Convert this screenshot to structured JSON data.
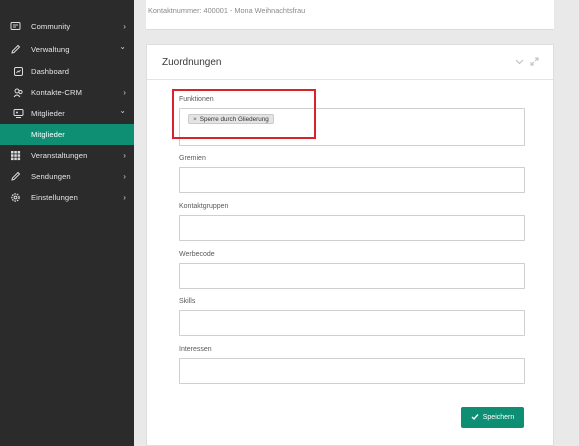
{
  "sidebar": {
    "items": [
      {
        "label": "Community",
        "icon": "community-icon"
      },
      {
        "label": "Verwaltung",
        "icon": "pencil-icon"
      },
      {
        "label": "Dashboard",
        "icon": "dashboard-icon"
      },
      {
        "label": "Kontakte-CRM",
        "icon": "contacts-icon"
      },
      {
        "label": "Mitglieder",
        "icon": "members-icon"
      },
      {
        "label": "Mitglieder",
        "active": true
      },
      {
        "label": "Veranstaltungen",
        "icon": "grid-icon"
      },
      {
        "label": "Sendungen",
        "icon": "pencil-icon"
      },
      {
        "label": "Einstellungen",
        "icon": "gear-icon"
      }
    ],
    "chevron_right": "›",
    "chevron_down": "⌄"
  },
  "header": {
    "contact_line": "Kontaktnummer: 400001 - Mona Weihnachtsfrau"
  },
  "panel": {
    "title": "Zuordnungen",
    "fields": [
      {
        "label": "Funktionen",
        "tags": [
          "Sperre durch Gliederung"
        ]
      },
      {
        "label": "Gremien"
      },
      {
        "label": "Kontaktgruppen"
      },
      {
        "label": "Werbecode"
      },
      {
        "label": "Skills"
      },
      {
        "label": "Interessen"
      }
    ],
    "tag_remove_symbol": "×",
    "save_label": "Speichern"
  },
  "colors": {
    "sidebar_bg": "#2b2b2b",
    "accent": "#0e8f74",
    "highlight": "#d9232b"
  }
}
